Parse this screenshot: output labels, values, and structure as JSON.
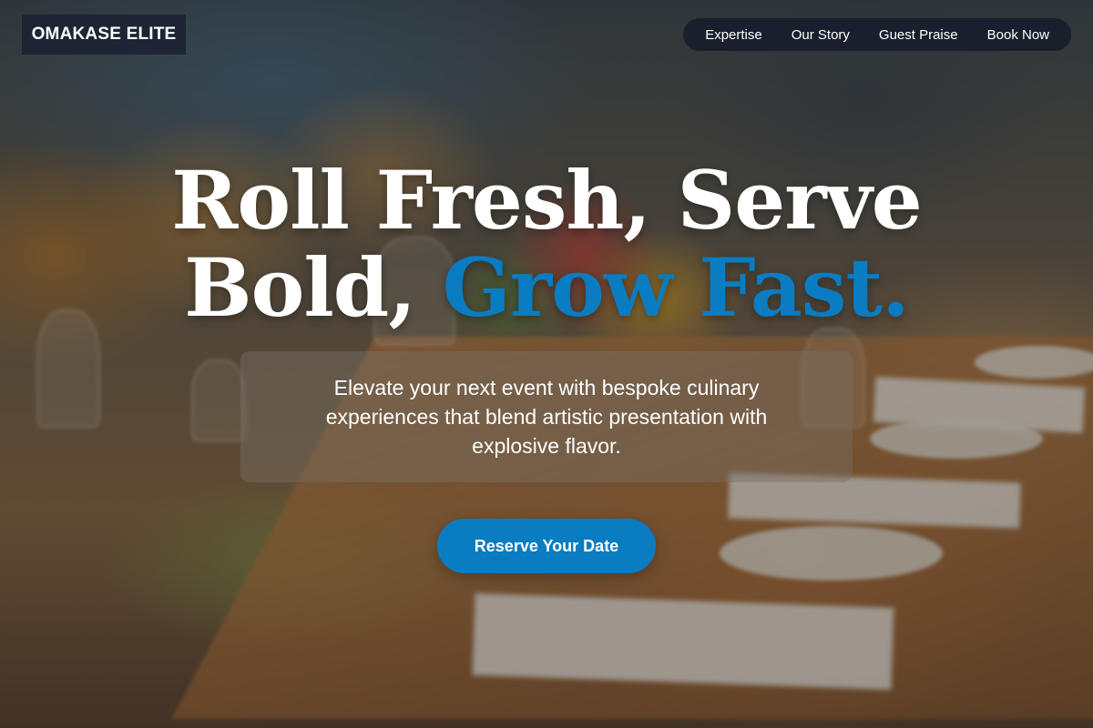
{
  "header": {
    "logo": "OMAKASE ELITE",
    "nav": [
      "Expertise",
      "Our Story",
      "Guest Praise",
      "Book Now"
    ]
  },
  "hero": {
    "title_line1": "Roll Fresh, Serve",
    "title_line2_plain": "Bold, ",
    "title_line2_accent": "Grow Fast.",
    "subtitle": "Elevate your next event with bespoke culinary experiences that blend artistic presentation with explosive flavor.",
    "cta_label": "Reserve Your Date"
  },
  "colors": {
    "accent": "#0a7cc1",
    "nav_background": "#161c2a",
    "logo_background": "#1d2433"
  },
  "background": {
    "image_subject": "blurred banquet table with plates, napkins, glasses and floral centerpiece"
  }
}
